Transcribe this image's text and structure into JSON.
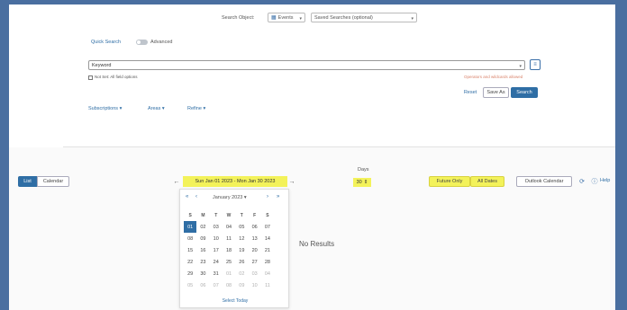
{
  "search_object": {
    "label": "Search Object:",
    "object_value": "Events",
    "summary_placeholder": "Saved Searches (optional)"
  },
  "filters": {
    "quick_search_label": "Quick Search",
    "advanced_label": "Advanced"
  },
  "query": {
    "value": "Keyword",
    "hint_text": "Not Set: All field options",
    "right_hint": "Operators and wildcards allowed"
  },
  "actions": {
    "reset_label": "Reset",
    "save_as_label": "Save As",
    "search_label": "Search"
  },
  "dropdown_links": [
    {
      "label": "Subscriptions"
    },
    {
      "label": "Areas"
    },
    {
      "label": "Refine"
    }
  ],
  "view": {
    "list_label": "List",
    "calendar_label": "Calendar"
  },
  "date_nav": {
    "range": "Sun Jan 01 2023 - Mon Jan 30 2023",
    "prev": "←",
    "next": "→"
  },
  "group": {
    "label": "Days",
    "value": "30"
  },
  "right_actions": {
    "future_only_label": "Future Only",
    "all_dates_label": "All Dates",
    "ics_label": "Outlook Calendar",
    "help_label": "Help"
  },
  "calendar": {
    "month_label": "January 2023",
    "prev_year": "«",
    "prev_month": "‹",
    "next_month": "›",
    "next_year": "»",
    "weekdays": [
      "S",
      "M",
      "T",
      "W",
      "T",
      "F",
      "S"
    ],
    "weeks": [
      [
        "01",
        "02",
        "03",
        "04",
        "05",
        "06",
        "07"
      ],
      [
        "08",
        "09",
        "10",
        "11",
        "12",
        "13",
        "14"
      ],
      [
        "15",
        "16",
        "17",
        "18",
        "19",
        "20",
        "21"
      ],
      [
        "22",
        "23",
        "24",
        "25",
        "26",
        "27",
        "28"
      ],
      [
        "29",
        "30",
        "31",
        "01",
        "02",
        "03",
        "04"
      ],
      [
        "05",
        "06",
        "07",
        "08",
        "09",
        "10",
        "11"
      ]
    ],
    "today_label": "Select Today"
  },
  "results": {
    "empty_label": "No Results"
  },
  "colors": {
    "primary": "#2f6ea5",
    "highlight": "#f3f25a",
    "frame": "#4a6fa0"
  }
}
